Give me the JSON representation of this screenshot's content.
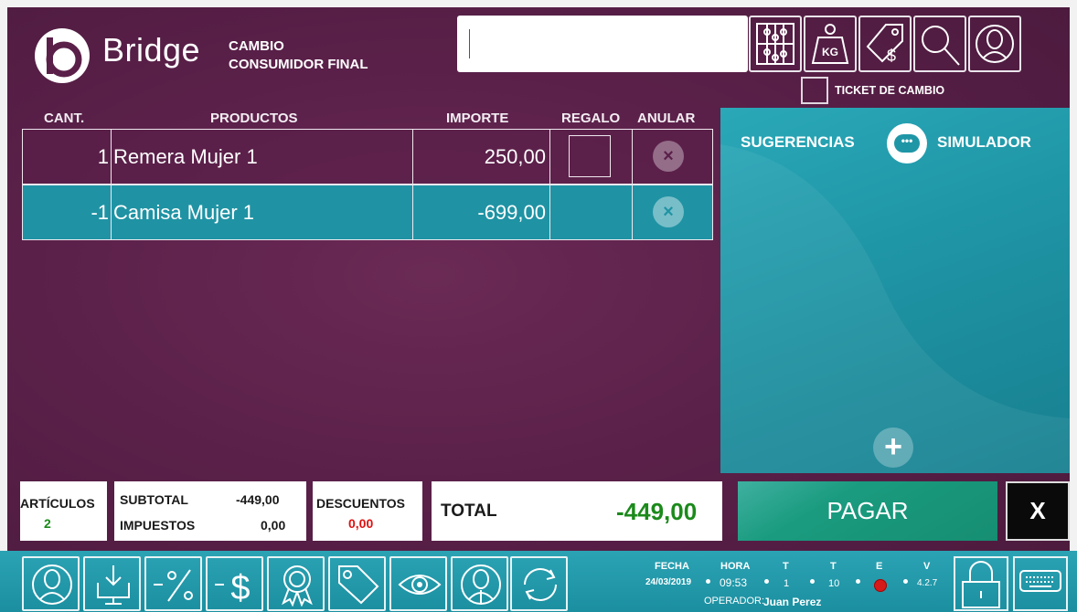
{
  "header": {
    "logo_text": "Bridge",
    "mode_line1": "CAMBIO",
    "mode_line2": "CONSUMIDOR FINAL",
    "search_value": "",
    "toolbar_icons": [
      "abacus-icon",
      "weight-kg-icon",
      "price-tag-icon",
      "search-icon",
      "customer-icon"
    ],
    "weight_label": "KG",
    "ticket_cambio_label": "TICKET DE CAMBIO",
    "ticket_cambio_checked": false
  },
  "table": {
    "columns": {
      "qty": "CANT.",
      "products": "PRODUCTOS",
      "amount": "IMPORTE",
      "gift": "REGALO",
      "void": "ANULAR"
    },
    "rows": [
      {
        "qty": "1",
        "product": "Remera Mujer 1",
        "amount": "250,00",
        "gift_checkbox": true
      },
      {
        "qty": "-1",
        "product": "Camisa Mujer 1",
        "amount": "-699,00",
        "gift_checkbox": false
      }
    ],
    "void_glyph": "×"
  },
  "suggestions": {
    "title_left": "SUGERENCIAS",
    "title_right": "SIMULADOR",
    "chat_glyph": "•••",
    "plus_glyph": "+"
  },
  "totals": {
    "articles_label": "ARTÍCULOS",
    "articles_value": "2",
    "subtotal_label": "SUBTOTAL",
    "subtotal_value": "-449,00",
    "taxes_label": "IMPUESTOS",
    "taxes_value": "0,00",
    "discounts_label": "DESCUENTOS",
    "discounts_value": "0,00",
    "total_label": "TOTAL",
    "total_value": "-449,00"
  },
  "actions": {
    "pay_label": "PAGAR",
    "close_label": "X"
  },
  "bottom_bar": {
    "icons": [
      "customer-icon",
      "download-icon",
      "percent-discount-icon",
      "dollar-discount-icon",
      "award-icon",
      "tag-icon",
      "eye-icon",
      "seller-icon",
      "refresh-icon"
    ],
    "fecha_label": "FECHA",
    "fecha_value": "24/03/2019",
    "hora_label": "HORA",
    "hora_value": "09:53",
    "t1_label": "T",
    "t1_value": "1",
    "t2_label": "T",
    "t2_value": "10",
    "e_label": "E",
    "e_status_color": "#d61a1a",
    "v_label": "V",
    "v_value": "4.2.7",
    "operator_label": "OPERADOR:",
    "operator_value": "Juan Perez"
  },
  "colors": {
    "background": "#5a2049",
    "accent_teal": "#1f96a6",
    "pay_green": "#1a9b7f",
    "total_green": "#1b8a1b",
    "discount_red": "#e01010"
  }
}
